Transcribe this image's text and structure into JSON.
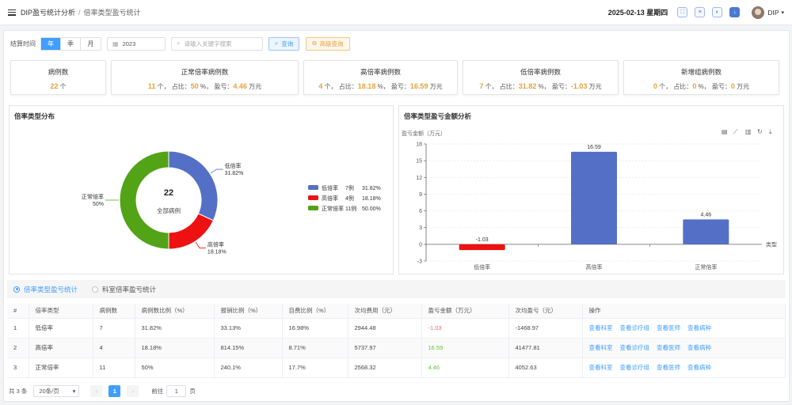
{
  "header": {
    "breadcrumb": [
      "DIP盈亏统计分析",
      "倍率类型盈亏统计"
    ],
    "separator": "/",
    "date": "2025-02-13 星期四",
    "user": "DIP"
  },
  "filter": {
    "label": "结算时间",
    "periods": [
      "年",
      "季",
      "月"
    ],
    "active_period": "年",
    "year": "2023",
    "search_placeholder": "请输入关键字搜索",
    "query_label": "查询",
    "advanced_label": "高级查询"
  },
  "stats": {
    "total": {
      "title": "病例数",
      "value": "22",
      "unit": "个"
    },
    "normal": {
      "title": "正常倍率病例数",
      "count": "11",
      "ratio": "50",
      "profit": "4.46"
    },
    "high": {
      "title": "高倍率病例数",
      "count": "4",
      "ratio": "18.18",
      "profit": "16.59"
    },
    "low": {
      "title": "低倍率病例数",
      "count": "7",
      "ratio": "31.82",
      "profit": "-1.03"
    },
    "new": {
      "title": "新增组病例数",
      "count": "0",
      "ratio": "0",
      "profit": "0"
    },
    "labels": {
      "unit_ge": "个，",
      "ratio_label": "占比：",
      "pct": "%，",
      "profit_label": "盈亏：",
      "wan": "万元"
    }
  },
  "panels": {
    "pie_title": "倍率类型分布",
    "bar_title": "倍率类型盈亏金额分析"
  },
  "chart_data": [
    {
      "type": "pie",
      "title": "倍率类型分布",
      "center_value": "22",
      "center_label": "全部病例",
      "slices": [
        {
          "name": "低倍率",
          "count": 7,
          "count_label": "7例",
          "pct": 31.82,
          "pct_label": "31.82%",
          "color": "#5470c6"
        },
        {
          "name": "高倍率",
          "count": 4,
          "count_label": "4例",
          "pct": 18.18,
          "pct_label": "18.18%",
          "color": "#ee1111"
        },
        {
          "name": "正常倍率",
          "count": 11,
          "count_label": "11例",
          "pct": 50.0,
          "pct_label": "50.00%",
          "color": "#52a316"
        }
      ],
      "outer_labels": [
        "31.82%",
        "18.18%",
        "50%"
      ]
    },
    {
      "type": "bar",
      "title": "倍率类型盈亏金额分析",
      "ylabel": "盈亏金额（万元）",
      "xlabel": "类型",
      "categories": [
        "低倍率",
        "高倍率",
        "正常倍率"
      ],
      "values": [
        -1.03,
        16.59,
        4.46
      ],
      "value_labels": [
        "-1.03",
        "16.59",
        "4.46"
      ],
      "colors": [
        "#ee1111",
        "#5470c6",
        "#5470c6"
      ],
      "ylim": [
        -3,
        18
      ],
      "yticks": [
        "-3",
        "0",
        "3",
        "6",
        "9",
        "12",
        "15",
        "18"
      ]
    }
  ],
  "tabs": [
    "倍率类型盈亏统计",
    "科室倍率盈亏统计"
  ],
  "table": {
    "columns": [
      "#",
      "倍率类型",
      "病例数",
      "病例数比例（%）",
      "报销比例（%）",
      "自费比例（%）",
      "次均费用（元）",
      "盈亏金额（万元）",
      "次均盈亏（元）",
      "操作"
    ],
    "rows": [
      [
        "1",
        "低倍率",
        "7",
        "31.82%",
        "33.13%",
        "16.98%",
        "2944.48",
        "-1.03",
        "-1468.97"
      ],
      [
        "2",
        "高倍率",
        "4",
        "18.18%",
        "814.15%",
        "8.71%",
        "5737.97",
        "16.59",
        "41477.81"
      ],
      [
        "3",
        "正常倍率",
        "11",
        "50%",
        "240.1%",
        "17.7%",
        "2568.32",
        "4.46",
        "4052.63"
      ]
    ],
    "actions": [
      "查看科室",
      "查看诊疗组",
      "查看医师",
      "查看病种"
    ]
  },
  "pager": {
    "total": "共 3 条",
    "size": "20条/页",
    "current": "1",
    "goto": "前往",
    "page_unit": "页",
    "prev": "‹",
    "next": "›"
  }
}
